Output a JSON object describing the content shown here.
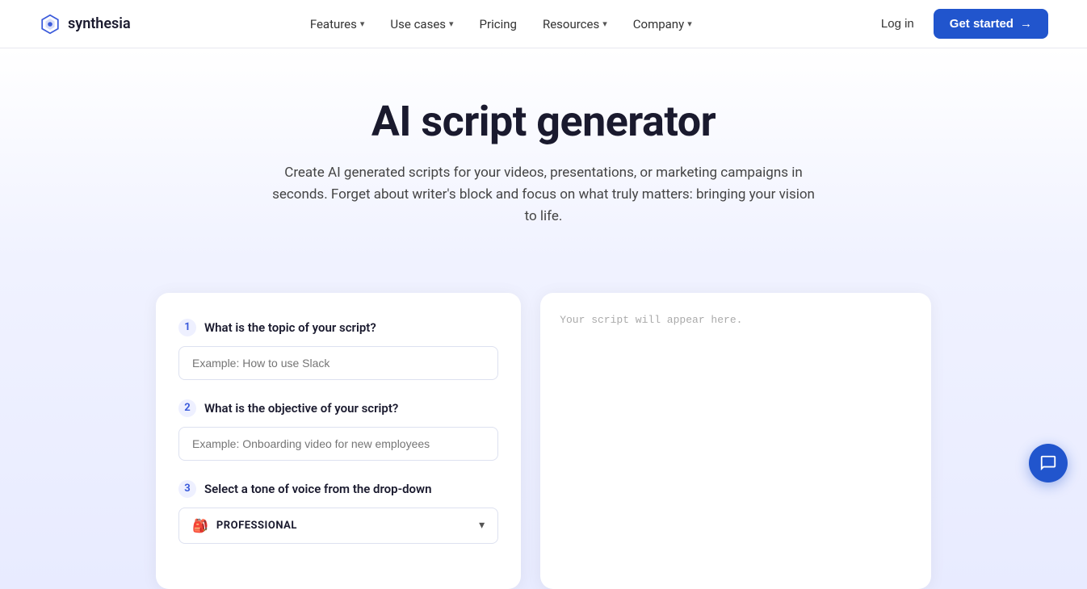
{
  "nav": {
    "logo_text": "synthesia",
    "items": [
      {
        "label": "Features",
        "has_dropdown": true
      },
      {
        "label": "Use cases",
        "has_dropdown": true
      },
      {
        "label": "Pricing",
        "has_dropdown": false
      },
      {
        "label": "Resources",
        "has_dropdown": true
      },
      {
        "label": "Company",
        "has_dropdown": true
      }
    ],
    "login_label": "Log in",
    "get_started_label": "Get started",
    "get_started_arrow": "→"
  },
  "hero": {
    "title": "AI script generator",
    "subtitle": "Create AI generated scripts for your videos, presentations, or marketing campaigns in seconds. Forget about writer's block and focus on what truly matters: bringing your vision to life."
  },
  "left_card": {
    "q1_number": "1",
    "q1_label": "What is the topic of your script?",
    "q1_placeholder": "Example: How to use Slack",
    "q2_number": "2",
    "q2_label": "What is the objective of your script?",
    "q2_placeholder": "Example: Onboarding video for new employees",
    "q3_number": "3",
    "q3_label": "Select a tone of voice from the drop-down",
    "q3_value": "PROFESSIONAL"
  },
  "right_card": {
    "placeholder_text": "Your script will appear here."
  },
  "chat": {
    "label": "chat-icon"
  },
  "colors": {
    "accent": "#2155cd",
    "accent_light": "#eef0ff",
    "accent_text": "#3b5bdb"
  }
}
